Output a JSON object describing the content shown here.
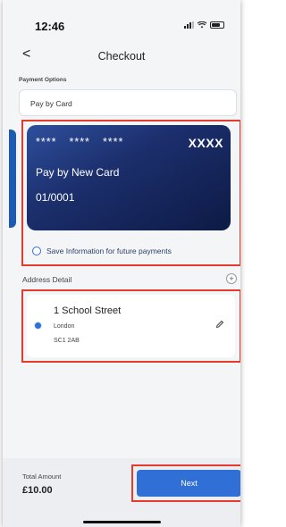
{
  "status_bar": {
    "time": "12:46"
  },
  "nav": {
    "back": "<",
    "title": "Checkout"
  },
  "payment": {
    "section_label": "Payment Options",
    "selected": "Pay by Card"
  },
  "card": {
    "group1": "****",
    "group2": "****",
    "group3": "****",
    "last": "XXXX",
    "name": "Pay by New Card",
    "expiry": "01/0001"
  },
  "save_option": {
    "label": "Save Information for future payments"
  },
  "address": {
    "heading": "Address Detail",
    "add": "+",
    "line1": "1 School Street",
    "city": "London",
    "postcode": "SC1 2AB"
  },
  "footer": {
    "total_label": "Total Amount",
    "total_value": "£10.00",
    "next_label": "Next"
  },
  "colors": {
    "accent": "#2f6fd6",
    "highlight_border": "#e53b2e",
    "card_dark": "#0d1a45"
  }
}
